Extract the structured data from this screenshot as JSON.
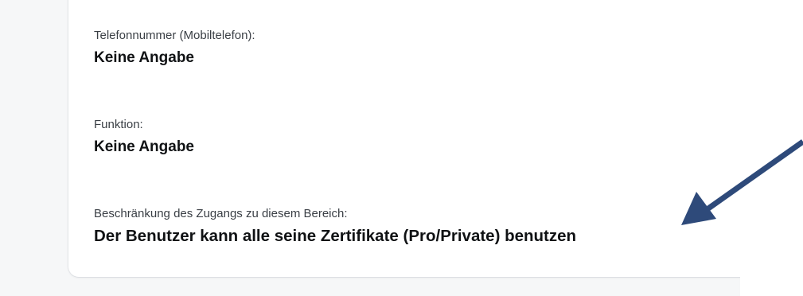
{
  "fields": [
    {
      "label": "Telefonnummer (Mobiltelefon):",
      "value": "Keine Angabe"
    },
    {
      "label": "Funktion:",
      "value": "Keine Angabe"
    },
    {
      "label": "Beschränkung des Zugangs zu diesem Bereich:",
      "value": "Der Benutzer kann alle seine Zertifikate (Pro/Private) benutzen"
    }
  ],
  "annotation": {
    "arrow_color": "#2e4a7a",
    "icon": "arrow-annotation"
  }
}
